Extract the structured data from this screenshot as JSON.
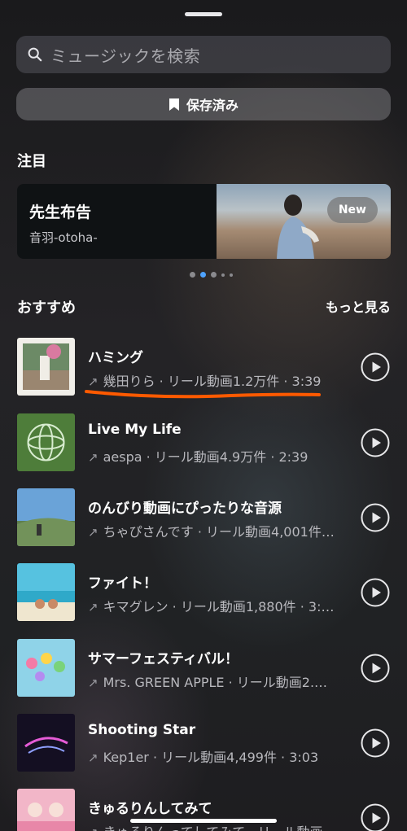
{
  "search": {
    "placeholder": "ミュージックを検索"
  },
  "saved_button": {
    "label": "保存済み"
  },
  "featured_section": {
    "title": "注目",
    "card": {
      "title": "先生布告",
      "artist": "音羽-otoha-",
      "badge": "New"
    }
  },
  "recommended": {
    "title": "おすすめ",
    "more": "もっと見る",
    "tracks": [
      {
        "title": "ハミング",
        "subtitle": "幾田りら · リール動画1.2万件 · 3:39"
      },
      {
        "title": "Live My Life",
        "subtitle": "aespa · リール動画4.9万件 · 2:39"
      },
      {
        "title": "のんびり動画にぴったりな音源",
        "subtitle": "ちゃぴさんです · リール動画4,001件…"
      },
      {
        "title": "ファイト！",
        "subtitle": "キマグレン · リール動画1,880件 · 3:…"
      },
      {
        "title": "サマーフェスティバル！",
        "subtitle": "Mrs. GREEN APPLE · リール動画2.…"
      },
      {
        "title": "Shooting Star",
        "subtitle": "Kep1er · リール動画4,499件 · 3:03"
      },
      {
        "title": "きゅるりんしてみて",
        "subtitle": "きゅるりんってしてみて · リール動画…"
      }
    ]
  },
  "colors": {
    "accent_dot": "#4ea3ff",
    "annotation_underline": "#ff5a00"
  },
  "carousel": {
    "pages": 5,
    "active_index": 1
  }
}
